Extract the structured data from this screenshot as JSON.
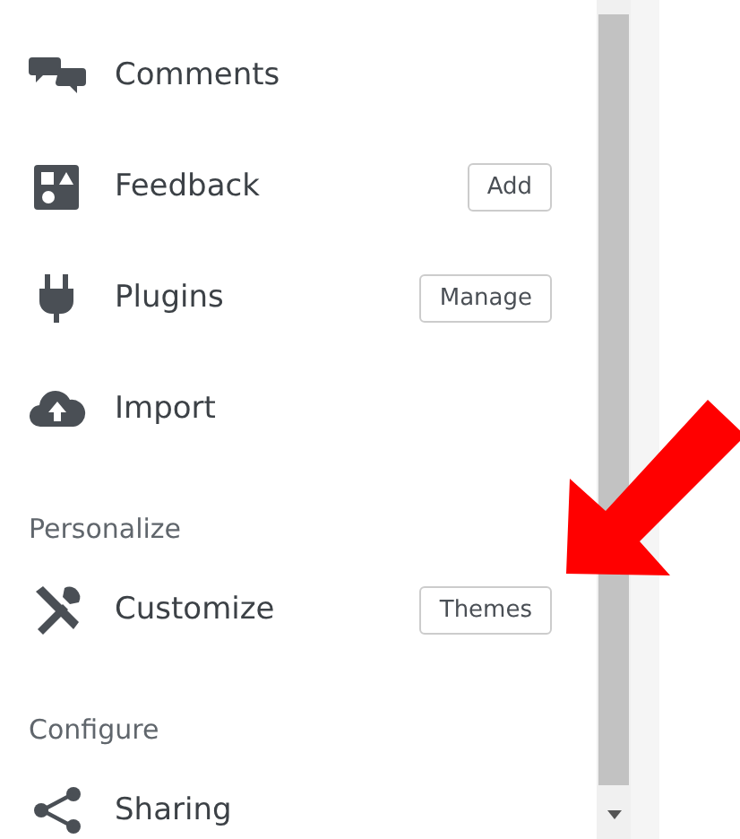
{
  "menu": [
    {
      "kind": "item",
      "label": "Comments"
    },
    {
      "kind": "item",
      "label": "Feedback",
      "button": "Add"
    },
    {
      "kind": "item",
      "label": "Plugins",
      "button": "Manage"
    },
    {
      "kind": "item",
      "label": "Import"
    },
    {
      "kind": "heading",
      "label": "Personalize"
    },
    {
      "kind": "item",
      "label": "Customize",
      "button": "Themes"
    },
    {
      "kind": "heading",
      "label": "Configure"
    },
    {
      "kind": "item",
      "label": "Sharing"
    }
  ]
}
